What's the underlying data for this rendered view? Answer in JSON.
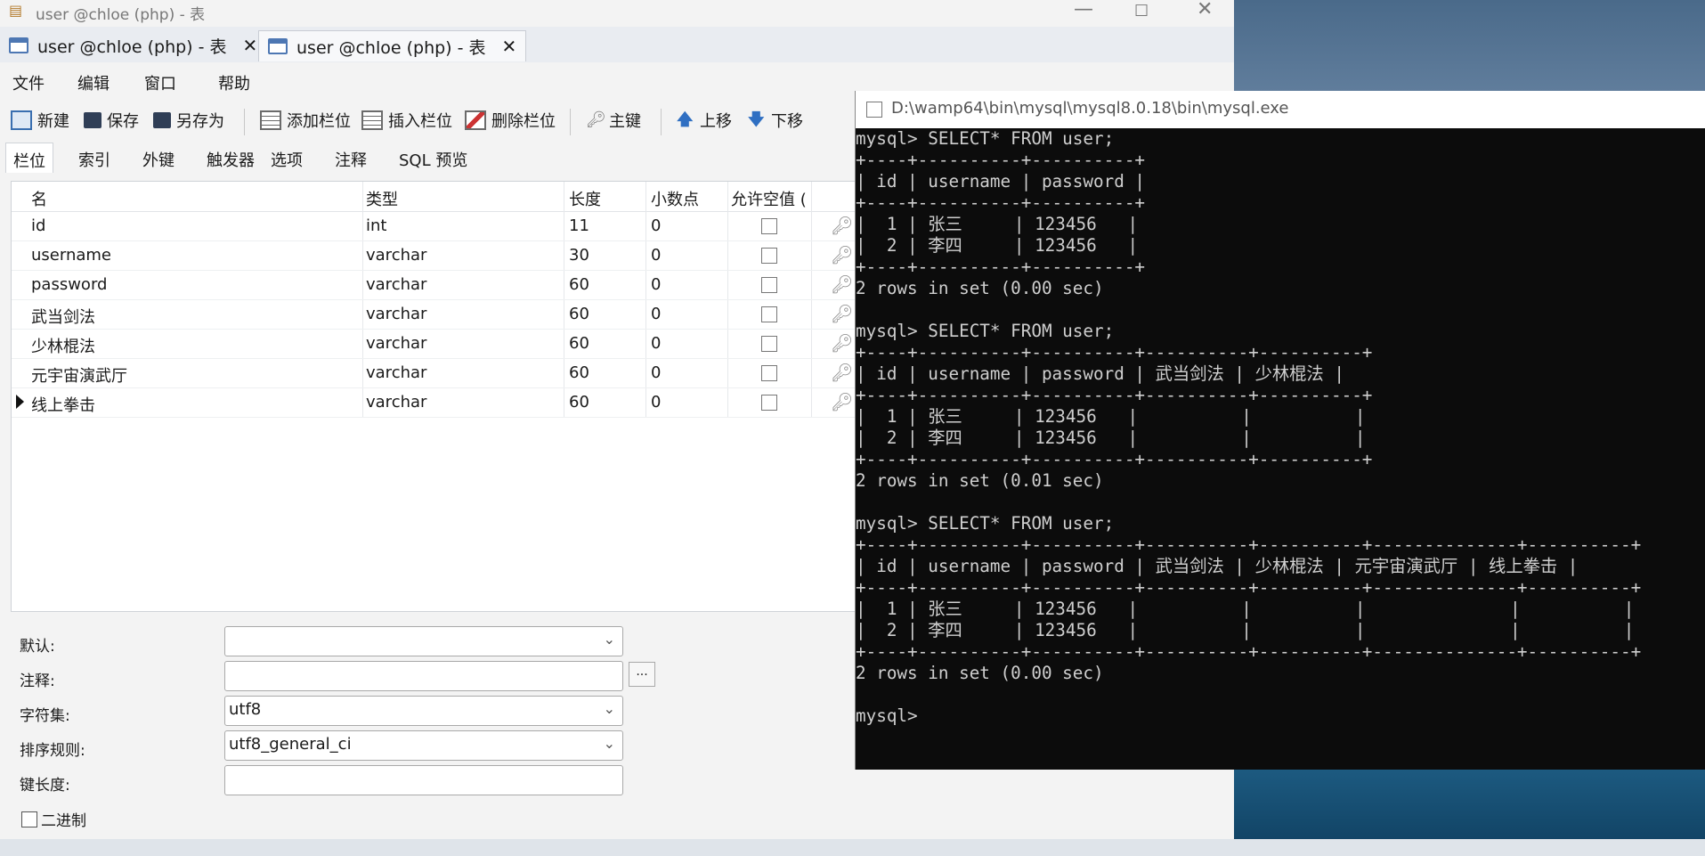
{
  "window": {
    "title": "user @chloe (php) - 表",
    "controls": {
      "minimize": "—",
      "maximize": "☐",
      "close": "✕"
    }
  },
  "tabs": [
    {
      "label": "user @chloe (php) - 表",
      "close": "✕"
    },
    {
      "label": "user @chloe (php) - 表",
      "close": "✕"
    }
  ],
  "menu": [
    "文件",
    "编辑",
    "窗口",
    "帮助"
  ],
  "toolbar": [
    "新建",
    "保存",
    "另存为",
    "添加栏位",
    "插入栏位",
    "删除栏位",
    "主键",
    "上移",
    "下移"
  ],
  "subtabs": [
    "栏位",
    "索引",
    "外键",
    "触发器",
    "选项",
    "注释",
    "SQL 预览"
  ],
  "grid": {
    "headers": [
      "名",
      "类型",
      "长度",
      "小数点",
      "允许空值 ("
    ],
    "rows": [
      {
        "name": "id",
        "type": "int",
        "length": "11",
        "decimals": "0"
      },
      {
        "name": "username",
        "type": "varchar",
        "length": "30",
        "decimals": "0"
      },
      {
        "name": "password",
        "type": "varchar",
        "length": "60",
        "decimals": "0"
      },
      {
        "name": "武当剑法",
        "type": "varchar",
        "length": "60",
        "decimals": "0"
      },
      {
        "name": "少林棍法",
        "type": "varchar",
        "length": "60",
        "decimals": "0"
      },
      {
        "name": "元宇宙演武厅",
        "type": "varchar",
        "length": "60",
        "decimals": "0"
      },
      {
        "name": "线上拳击",
        "type": "varchar",
        "length": "60",
        "decimals": "0"
      }
    ]
  },
  "props": {
    "default_label": "默认:",
    "default_value": "",
    "comment_label": "注释:",
    "comment_value": "",
    "comment_more": "...",
    "charset_label": "字符集:",
    "charset_value": "utf8",
    "collation_label": "排序规则:",
    "collation_value": "utf8_general_ci",
    "keylen_label": "键长度:",
    "keylen_value": "",
    "binary_label": "二进制"
  },
  "console": {
    "title": "D:\\wamp64\\bin\\mysql\\mysql8.0.18\\bin\\mysql.exe",
    "output": "mysql> SELECT* FROM user;\n+----+----------+----------+\n| id | username | password |\n+----+----------+----------+\n|  1 | 张三     | 123456   |\n|  2 | 李四     | 123456   |\n+----+----------+----------+\n2 rows in set (0.00 sec)\n\nmysql> SELECT* FROM user;\n+----+----------+----------+----------+----------+\n| id | username | password | 武当剑法 | 少林棍法 |\n+----+----------+----------+----------+----------+\n|  1 | 张三     | 123456   |          |          |\n|  2 | 李四     | 123456   |          |          |\n+----+----------+----------+----------+----------+\n2 rows in set (0.01 sec)\n\nmysql> SELECT* FROM user;\n+----+----------+----------+----------+----------+--------------+----------+\n| id | username | password | 武当剑法 | 少林棍法 | 元宇宙演武厅 | 线上拳击 |\n+----+----------+----------+----------+----------+--------------+----------+\n|  1 | 张三     | 123456   |          |          |              |          |\n|  2 | 李四     | 123456   |          |          |              |          |\n+----+----------+----------+----------+----------+--------------+----------+\n2 rows in set (0.00 sec)\n\nmysql>"
  }
}
